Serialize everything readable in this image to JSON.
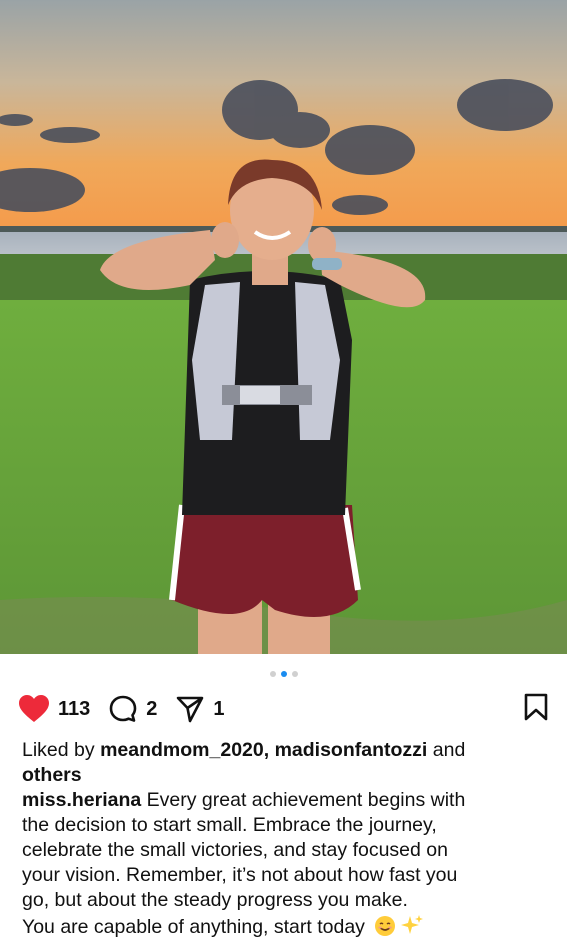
{
  "post": {
    "carousel": {
      "count": 3,
      "active_index": 1
    },
    "actions": {
      "likes_count": "113",
      "comments_count": "2",
      "shares_count": "1"
    },
    "liked_by": {
      "prefix": "Liked by ",
      "user1": "meandmom_2020",
      "separator": ", ",
      "user2": "madisonfantozzi",
      "middle": " and",
      "others": "others"
    },
    "caption": {
      "username": "miss.heriana",
      "line1": " Every great achievement begins with",
      "line2": "the decision to start small. Embrace the journey,",
      "line3": "celebrate the small victories, and stay focused on",
      "line4": "your vision. Remember, it’s not about how fast you",
      "line5": "go, but about the steady progress you make.",
      "line6": "You are capable of anything, start today"
    }
  },
  "colors": {
    "like_red": "#ed2a3a",
    "dot_active": "#1a8cf0",
    "dot_inactive": "#d0d0d0"
  },
  "icons": [
    "heart-icon",
    "comment-icon",
    "share-icon",
    "bookmark-icon",
    "smile-emoji-icon",
    "sparkles-emoji-icon"
  ]
}
